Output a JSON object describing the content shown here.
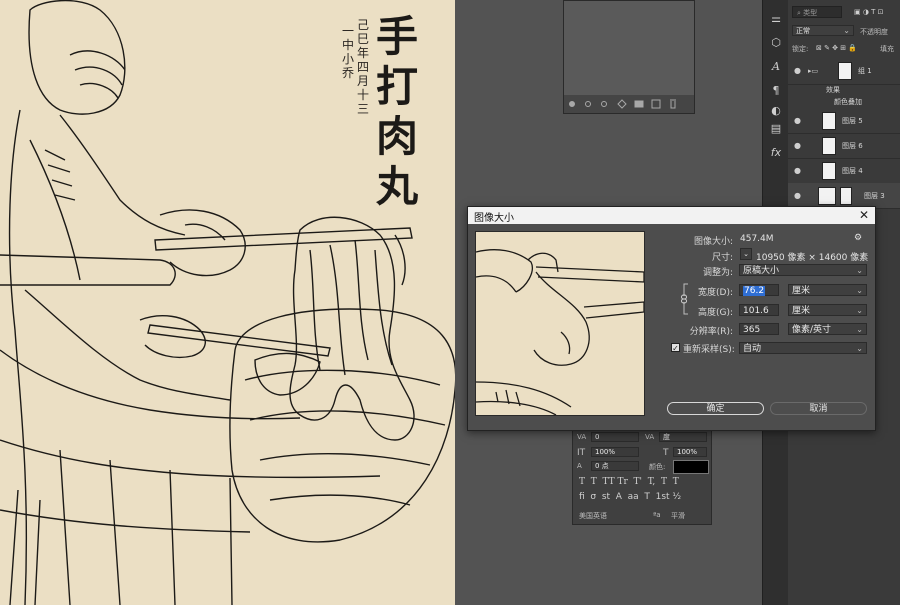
{
  "artwork": {
    "title_chars": "手打肉丸",
    "signature_col1": "己巳年四月十三",
    "signature_col2": "一中小乔"
  },
  "dialog": {
    "title": "图像大小",
    "image_size_label": "图像大小:",
    "image_size_value": "457.4M",
    "dimensions_label": "尺寸:",
    "dimensions_value": "10950 像素 × 14600 像素",
    "fit_to_label": "调整为:",
    "fit_to_value": "原稿大小",
    "width_label": "宽度(D):",
    "width_value": "76.2",
    "width_unit": "厘米",
    "height_label": "高度(G):",
    "height_value": "101.6",
    "height_unit": "厘米",
    "resolution_label": "分辨率(R):",
    "resolution_value": "365",
    "resolution_unit": "像素/英寸",
    "resample_label": "重新采样(S):",
    "resample_value": "自动",
    "ok_label": "确定",
    "cancel_label": "取消",
    "close_glyph": "✕",
    "gear_glyph": "⚙"
  },
  "layers": {
    "search_placeholder": "类型",
    "blend_mode": "正常",
    "opacity_label": "不透明度",
    "lock_label": "锁定:",
    "fill_label": "填充",
    "group_name": "组 1",
    "effects_label": "效果",
    "color_overlay_label": "颜色叠加",
    "items": [
      {
        "name": "图层 5"
      },
      {
        "name": "图层 6"
      },
      {
        "name": "图层 4"
      },
      {
        "name": "图层 3"
      }
    ]
  },
  "character_panel": {
    "tracking_value": "0",
    "kerning_value": "度",
    "vscale": "100%",
    "hscale": "100%",
    "baseline": "0 点",
    "color_label": "颜色:",
    "language": "美国英语",
    "aa_value": "平滑",
    "aa_glyph": "ªa"
  },
  "colors": {
    "paper": "#ebdfc4",
    "ink": "#1c1a17",
    "highlight": "#2f6ed3"
  }
}
